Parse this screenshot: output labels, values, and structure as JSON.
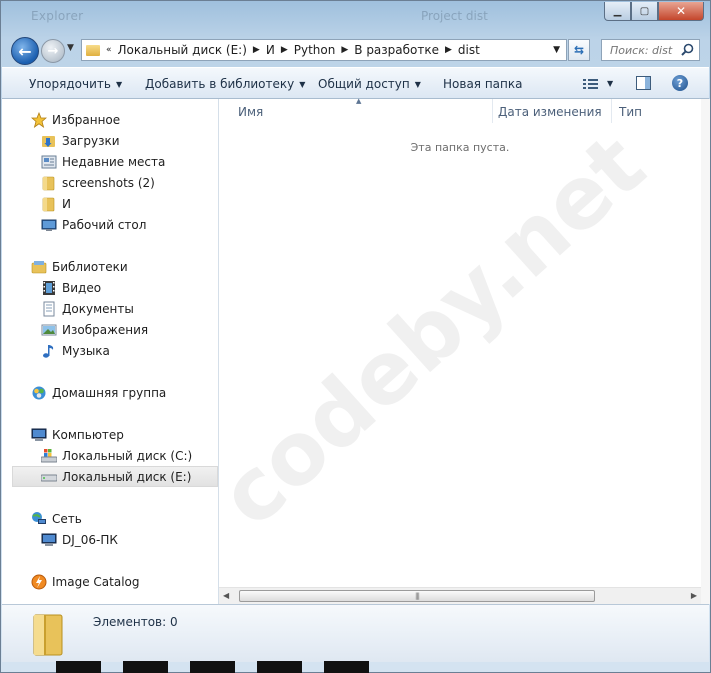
{
  "titlebar": {
    "ghost_left": "Explorer",
    "ghost_right": "Project dist"
  },
  "nav": {
    "back_icon": "back-arrow-icon",
    "forward_icon": "forward-arrow-icon"
  },
  "address": {
    "prefix": "«",
    "crumbs": [
      "Локальный диск (E:)",
      "И",
      "Python",
      "В разработке",
      "dist"
    ]
  },
  "search": {
    "placeholder": "Поиск: dist"
  },
  "toolbar": {
    "organize": "Упорядочить",
    "add_library": "Добавить в библиотеку",
    "share": "Общий доступ",
    "new_folder": "Новая папка"
  },
  "sidebar": {
    "favorites": {
      "label": "Избранное",
      "items": [
        "Загрузки",
        "Недавние места",
        "screenshots (2)",
        "И",
        "Рабочий стол"
      ]
    },
    "libraries": {
      "label": "Библиотеки",
      "items": [
        "Видео",
        "Документы",
        "Изображения",
        "Музыка"
      ]
    },
    "homegroup": {
      "label": "Домашняя группа"
    },
    "computer": {
      "label": "Компьютер",
      "items": [
        "Локальный диск (C:)",
        "Локальный диск (E:)"
      ],
      "selected": "Локальный диск (E:)"
    },
    "network": {
      "label": "Сеть",
      "items": [
        "DJ_06-ПК"
      ]
    },
    "image_catalog": {
      "label": "Image Catalog"
    }
  },
  "columns": {
    "name": "Имя",
    "date": "Дата изменения",
    "type": "Тип"
  },
  "content": {
    "empty_text": "Эта папка пуста."
  },
  "details": {
    "count_label": "Элементов: 0"
  },
  "watermark": "codeby.net",
  "colors": {
    "accent": "#2a6db5",
    "folder": "#e8c25a",
    "selection": "#e5e5e5"
  }
}
